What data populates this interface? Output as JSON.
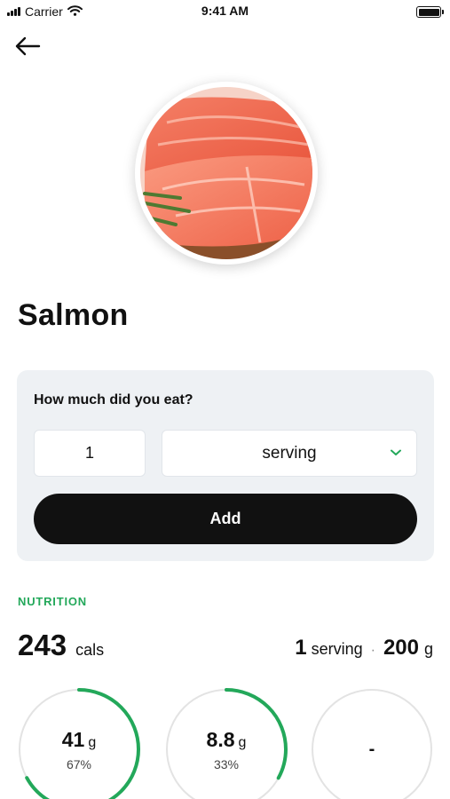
{
  "status_bar": {
    "carrier": "Carrier",
    "time": "9:41 AM"
  },
  "food": {
    "name": "Salmon",
    "image": "salmon-fillet-photo"
  },
  "amount": {
    "question": "How much did you eat?",
    "quantity": "1",
    "unit": "serving",
    "add_label": "Add"
  },
  "nutrition": {
    "heading": "NUTRITION",
    "calories": "243",
    "calories_unit": "cals",
    "serving_qty": "1",
    "serving_unit": "serving",
    "separator": "·",
    "weight": "200",
    "weight_unit": "g",
    "rings": [
      {
        "value": "41",
        "unit": "g",
        "percent_label": "67%",
        "fraction": 0.67
      },
      {
        "value": "8.8",
        "unit": "g",
        "percent_label": "33%",
        "fraction": 0.33
      },
      {
        "value": "-"
      }
    ]
  },
  "colors": {
    "accent": "#23a85a",
    "card_bg": "#eef1f4",
    "button_bg": "#111111",
    "ring_track": "#e3e3e3"
  }
}
